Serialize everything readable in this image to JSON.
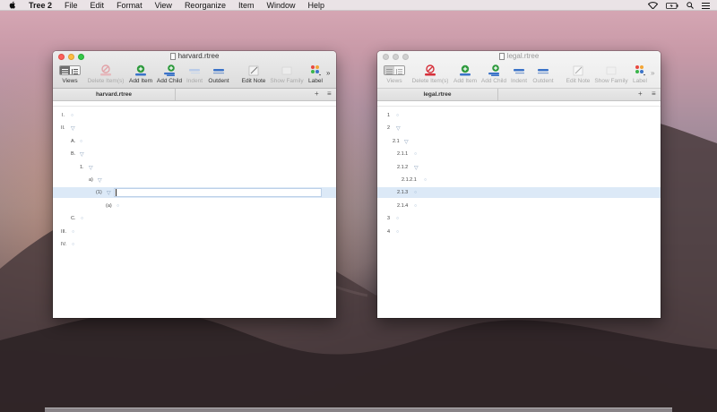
{
  "menubar": {
    "app_name": "Tree 2",
    "items": [
      "File",
      "Edit",
      "Format",
      "View",
      "Reorganize",
      "Item",
      "Window",
      "Help"
    ]
  },
  "toolbar_labels": {
    "views": "Views",
    "delete": "Delete Item(s)",
    "add_item": "Add Item",
    "add_child": "Add Child",
    "indent": "Indent",
    "outdent": "Outdent",
    "edit_note": "Edit Note",
    "show_family": "Show Family",
    "label": "Label"
  },
  "windows": [
    {
      "title": "harvard.rtree",
      "tab": "harvard.rtree",
      "active": true,
      "rows": [
        {
          "num": "I.",
          "expanded": false
        },
        {
          "num": "II.",
          "expanded": true
        },
        {
          "num": "A.",
          "expanded": false
        },
        {
          "num": "B.",
          "expanded": true
        },
        {
          "num": "1.",
          "expanded": true
        },
        {
          "num": "a)",
          "expanded": true
        },
        {
          "num": "(1)",
          "expanded": true,
          "selected": true,
          "editing": true
        },
        {
          "num": "(a)",
          "expanded": false
        },
        {
          "num": "C.",
          "expanded": false
        },
        {
          "num": "III.",
          "expanded": false
        },
        {
          "num": "IV.",
          "expanded": false
        }
      ]
    },
    {
      "title": "legal.rtree",
      "tab": "legal.rtree",
      "active": false,
      "rows": [
        {
          "num": "1",
          "expanded": false
        },
        {
          "num": "2",
          "expanded": true
        },
        {
          "num": "2.1",
          "expanded": true
        },
        {
          "num": "2.1.1",
          "expanded": false
        },
        {
          "num": "2.1.2",
          "expanded": true
        },
        {
          "num": "2.1.2.1",
          "expanded": false
        },
        {
          "num": "2.1.3",
          "expanded": false,
          "selected": true
        },
        {
          "num": "2.1.4",
          "expanded": false
        },
        {
          "num": "3",
          "expanded": false
        },
        {
          "num": "4",
          "expanded": false
        }
      ]
    }
  ],
  "tab_buttons": {
    "add": "+",
    "menu": "≡"
  },
  "overflow_chevron": "»",
  "colors": {
    "selection": "#dce9f7",
    "delete_icon": "#d6303a",
    "add_icon": "#2e9a3d",
    "indent_bar": "#3b73c8"
  }
}
